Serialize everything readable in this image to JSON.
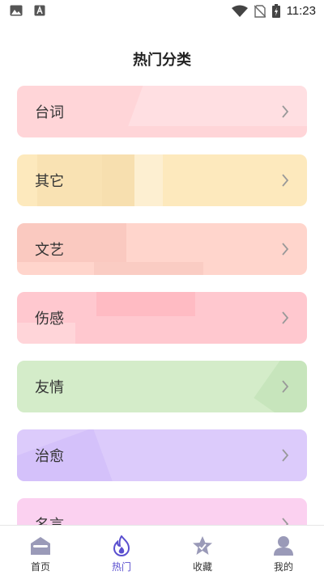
{
  "status_bar": {
    "time": "11:23",
    "left_icons": [
      "image-icon",
      "font-a-icon"
    ],
    "right_icons": [
      "wifi-icon",
      "no-sim-icon",
      "battery-charging-icon"
    ]
  },
  "header": {
    "title": "热门分类"
  },
  "categories": [
    {
      "label": "台词",
      "color": "#ffd5d8"
    },
    {
      "label": "其它",
      "color": "#fde9bd"
    },
    {
      "label": "文艺",
      "color": "#ffd5cc"
    },
    {
      "label": "伤感",
      "color": "#ffc8cf"
    },
    {
      "label": "友情",
      "color": "#d4ecc9"
    },
    {
      "label": "治愈",
      "color": "#dccbfb"
    },
    {
      "label": "名言",
      "color": "#fbd1f0"
    }
  ],
  "nav": {
    "items": [
      {
        "label": "首页",
        "icon": "home-icon"
      },
      {
        "label": "热门",
        "icon": "flame-icon"
      },
      {
        "label": "收藏",
        "icon": "star-icon"
      },
      {
        "label": "我的",
        "icon": "user-icon"
      }
    ],
    "active_index": 1,
    "active_color": "#5a4fcf",
    "inactive_icon_color": "#9a9ab8"
  }
}
